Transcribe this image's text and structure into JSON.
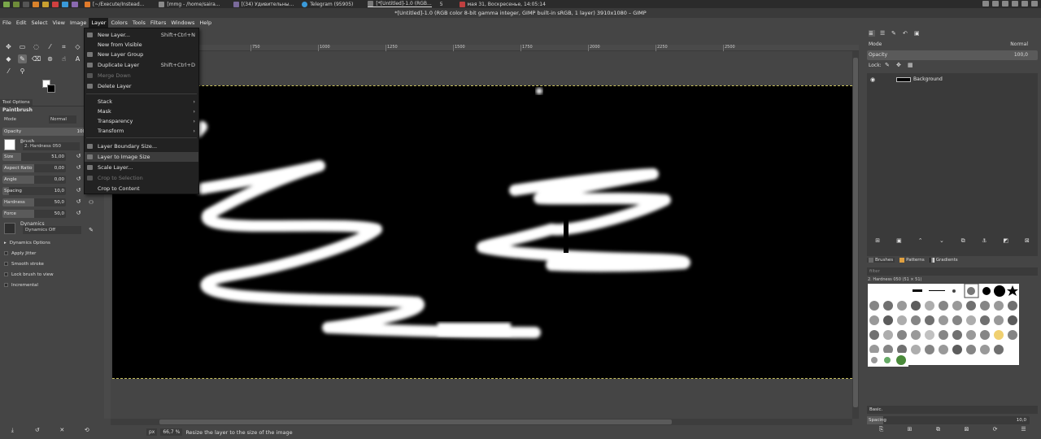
{
  "taskbar": {
    "tasks": [
      {
        "label": "[~/Execute/Instead...",
        "color": "#e07a2a"
      },
      {
        "label": "[mmg - /home/saira...",
        "color": "#8a8a8a"
      },
      {
        "label": "[(34) Удивительны...",
        "color": "#7a6a9a"
      },
      {
        "label": "Telegram (95905)",
        "color": "#3a9ad9"
      },
      {
        "label": "[*[Untitled]-1.0 (RGB...",
        "color": "#7a7a7a",
        "active": true
      }
    ],
    "indicator": "5",
    "clock": "мая 31, Воскресенье, 14:05:14"
  },
  "window": {
    "title": "*[Untitled]-1.0 (RGB color 8-bit gamma integer, GIMP built-in sRGB, 1 layer) 3910x1080 – GIMP"
  },
  "menubar": [
    "File",
    "Edit",
    "Select",
    "View",
    "Image",
    "Layer",
    "Colors",
    "Tools",
    "Filters",
    "Windows",
    "Help"
  ],
  "layer_menu": {
    "items": [
      {
        "label": "New Layer...",
        "shortcut": "Shift+Ctrl+N"
      },
      {
        "label": "New from Visible",
        "shortcut": ""
      },
      {
        "label": "New Layer Group",
        "shortcut": ""
      },
      {
        "label": "Duplicate Layer",
        "shortcut": "Shift+Ctrl+D"
      },
      {
        "label": "Merge Down",
        "shortcut": "",
        "disabled": true
      },
      {
        "label": "Delete Layer",
        "shortcut": ""
      },
      {
        "label": "Stack",
        "submenu": true
      },
      {
        "label": "Mask",
        "submenu": true
      },
      {
        "label": "Transparency",
        "submenu": true
      },
      {
        "label": "Transform",
        "submenu": true
      },
      {
        "label": "Layer Boundary Size...",
        "shortcut": ""
      },
      {
        "label": "Layer to Image Size",
        "shortcut": "",
        "highlighted": true
      },
      {
        "label": "Scale Layer...",
        "shortcut": ""
      },
      {
        "label": "Crop to Selection",
        "shortcut": "",
        "disabled": true
      },
      {
        "label": "Crop to Content",
        "shortcut": ""
      }
    ]
  },
  "tool_options": {
    "tab_label": "Tool Options",
    "tool_name": "Paintbrush",
    "mode_label": "Mode",
    "mode_value": "Normal",
    "opacity_label": "Opacity",
    "opacity_value": "100",
    "brush_label": "Brush",
    "brush_value": "2. Hardness 050",
    "sliders": [
      {
        "label": "Size",
        "value": "51,00",
        "level": 0.3
      },
      {
        "label": "Aspect Ratio",
        "value": "0,00",
        "level": 0.5
      },
      {
        "label": "Angle",
        "value": "0,00",
        "level": 0.5
      },
      {
        "label": "Spacing",
        "value": "10,0",
        "level": 0.1
      },
      {
        "label": "Hardness",
        "value": "50,0",
        "level": 0.5
      },
      {
        "label": "Force",
        "value": "50,0",
        "level": 0.5
      }
    ],
    "dynamics_label": "Dynamics",
    "dynamics_value": "Dynamics Off",
    "checkboxes": [
      "Dynamics Options",
      "Apply Jitter",
      "Smooth stroke",
      "Lock brush to view",
      "Incremental"
    ]
  },
  "ruler_ticks": [
    "750",
    "1000",
    "1250",
    "1500",
    "1750",
    "2000",
    "2250",
    "2500"
  ],
  "statusbar": {
    "unit": "px",
    "zoom": "66,7 %",
    "message": "Resize the layer to the size of the image"
  },
  "layers_panel": {
    "mode_label": "Mode",
    "mode_value": "Normal",
    "opacity_label": "Opacity",
    "opacity_value": "100,0",
    "lock_label": "Lock:",
    "layers": [
      {
        "name": "Background",
        "visible": true
      }
    ]
  },
  "brushes_panel": {
    "tabs": [
      "Brushes",
      "Patterns",
      "Gradients"
    ],
    "filter_placeholder": "filter",
    "selected_brush": "2. Hardness 050 (51 × 51)",
    "preset": "Basic.",
    "spacing_label": "Spacing",
    "spacing_value": "10,0"
  },
  "colors": {
    "foreground": "#ffffff",
    "background": "#000000",
    "selection_border": "#c8c060"
  }
}
